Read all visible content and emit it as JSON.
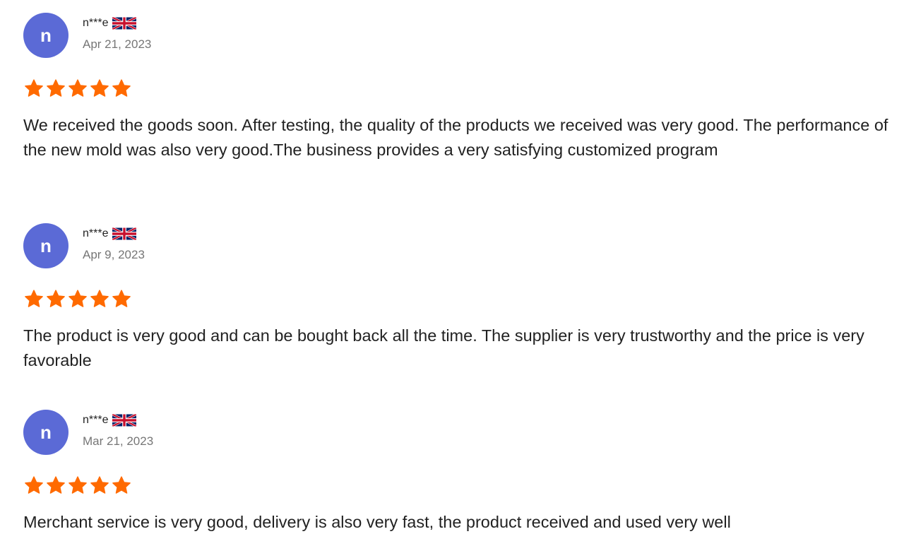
{
  "accent": {
    "avatar_bg": "#5b6ad6",
    "star": "#ff6a00"
  },
  "reviews": [
    {
      "avatar_letter": "n",
      "username": "n***e",
      "flag": "uk-flag-icon",
      "date": "Apr 21, 2023",
      "rating": 5,
      "text": "We received the goods soon. After testing, the quality of the products we received was very good. The performance of the new mold was also very good.The business provides a very satisfying customized program"
    },
    {
      "avatar_letter": "n",
      "username": "n***e",
      "flag": "uk-flag-icon",
      "date": "Apr 9, 2023",
      "rating": 5,
      "text": "The product is very good and can be bought back all the time. The supplier is very trustworthy and the price is very favorable"
    },
    {
      "avatar_letter": "n",
      "username": "n***e",
      "flag": "uk-flag-icon",
      "date": "Mar 21, 2023",
      "rating": 5,
      "text": "Merchant service is very good, delivery is also very fast, the product received and used very well"
    }
  ]
}
